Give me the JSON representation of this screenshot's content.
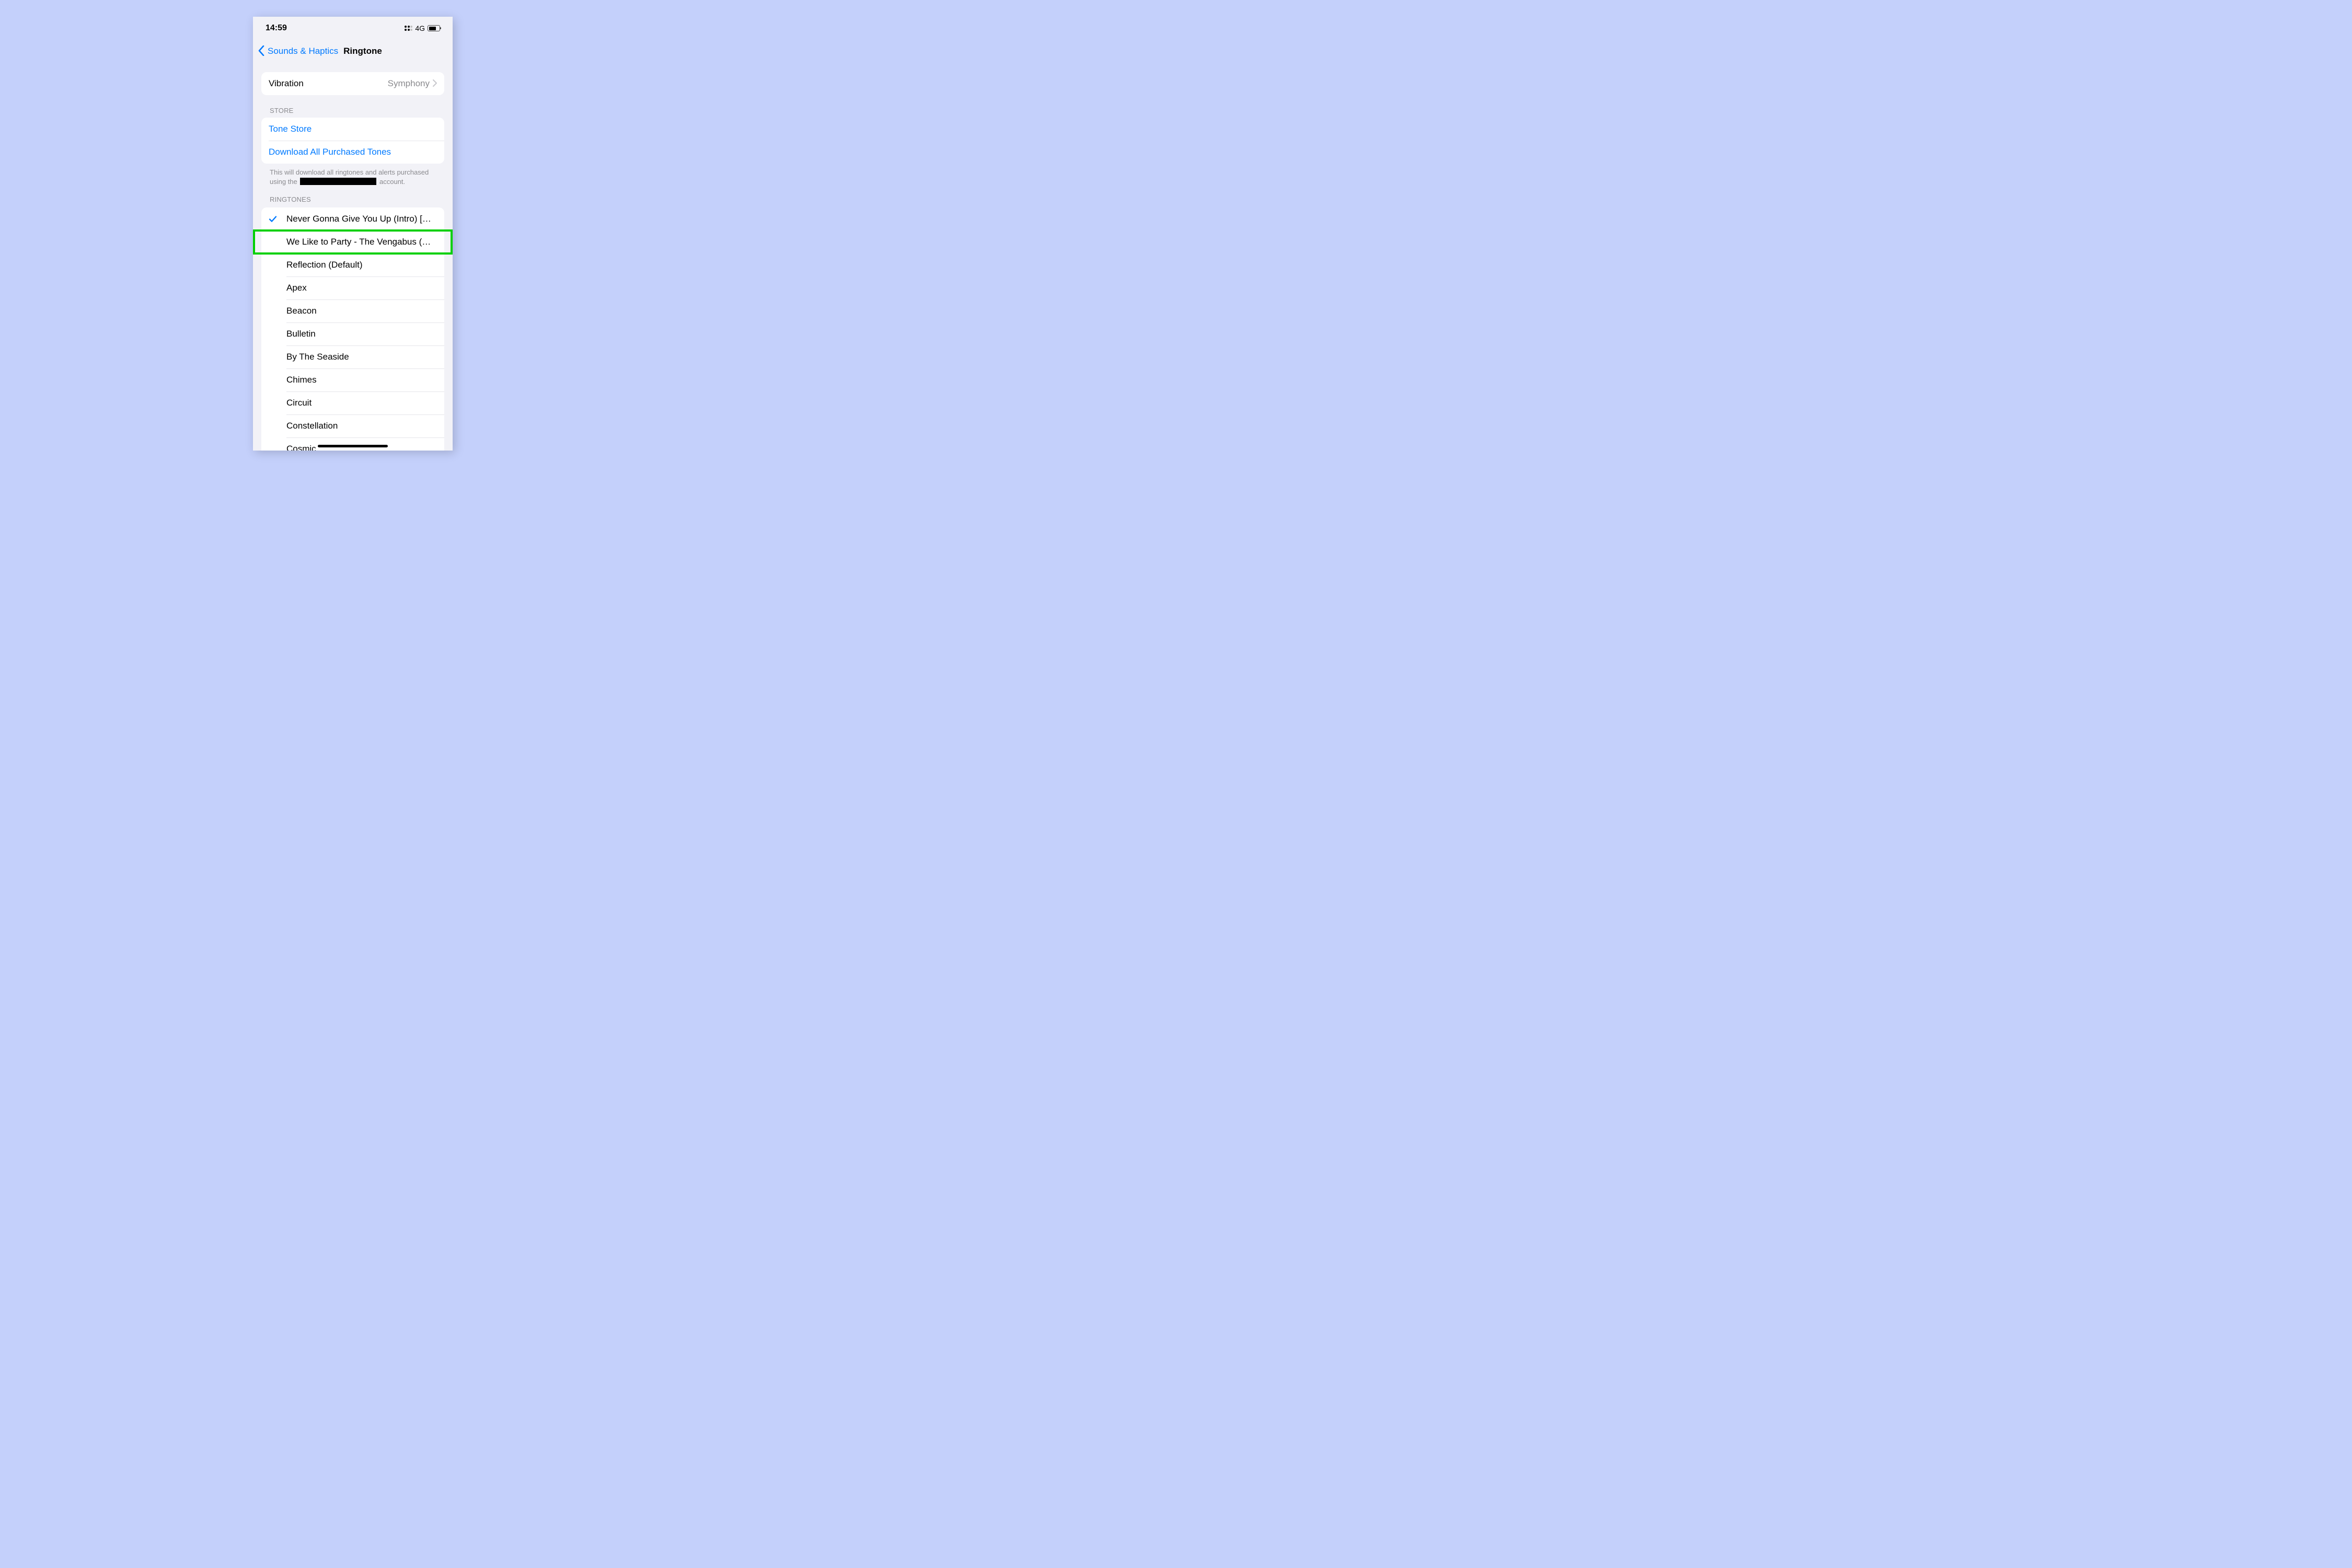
{
  "status_bar": {
    "time": "14:59",
    "network": "4G"
  },
  "nav": {
    "back_label": "Sounds & Haptics",
    "title": "Ringtone"
  },
  "vibration": {
    "label": "Vibration",
    "value": "Symphony"
  },
  "store": {
    "header": "STORE",
    "tone_store": "Tone Store",
    "download_all": "Download All Purchased Tones",
    "footer_pre": "This will download all ringtones and alerts purchased using the",
    "footer_post": "account."
  },
  "ringtones": {
    "header": "RINGTONES",
    "items": [
      {
        "label": "Never Gonna Give You Up (Intro) [Origi…",
        "selected": true
      },
      {
        "label": "We Like to Party - The Vengabus (Ring…",
        "selected": false,
        "highlighted": true
      },
      {
        "label": "Reflection (Default)",
        "selected": false
      },
      {
        "label": "Apex",
        "selected": false
      },
      {
        "label": "Beacon",
        "selected": false
      },
      {
        "label": "Bulletin",
        "selected": false
      },
      {
        "label": "By The Seaside",
        "selected": false
      },
      {
        "label": "Chimes",
        "selected": false
      },
      {
        "label": "Circuit",
        "selected": false
      },
      {
        "label": "Constellation",
        "selected": false
      },
      {
        "label": "Cosmic",
        "selected": false
      }
    ]
  },
  "highlight_color": "#00d000"
}
